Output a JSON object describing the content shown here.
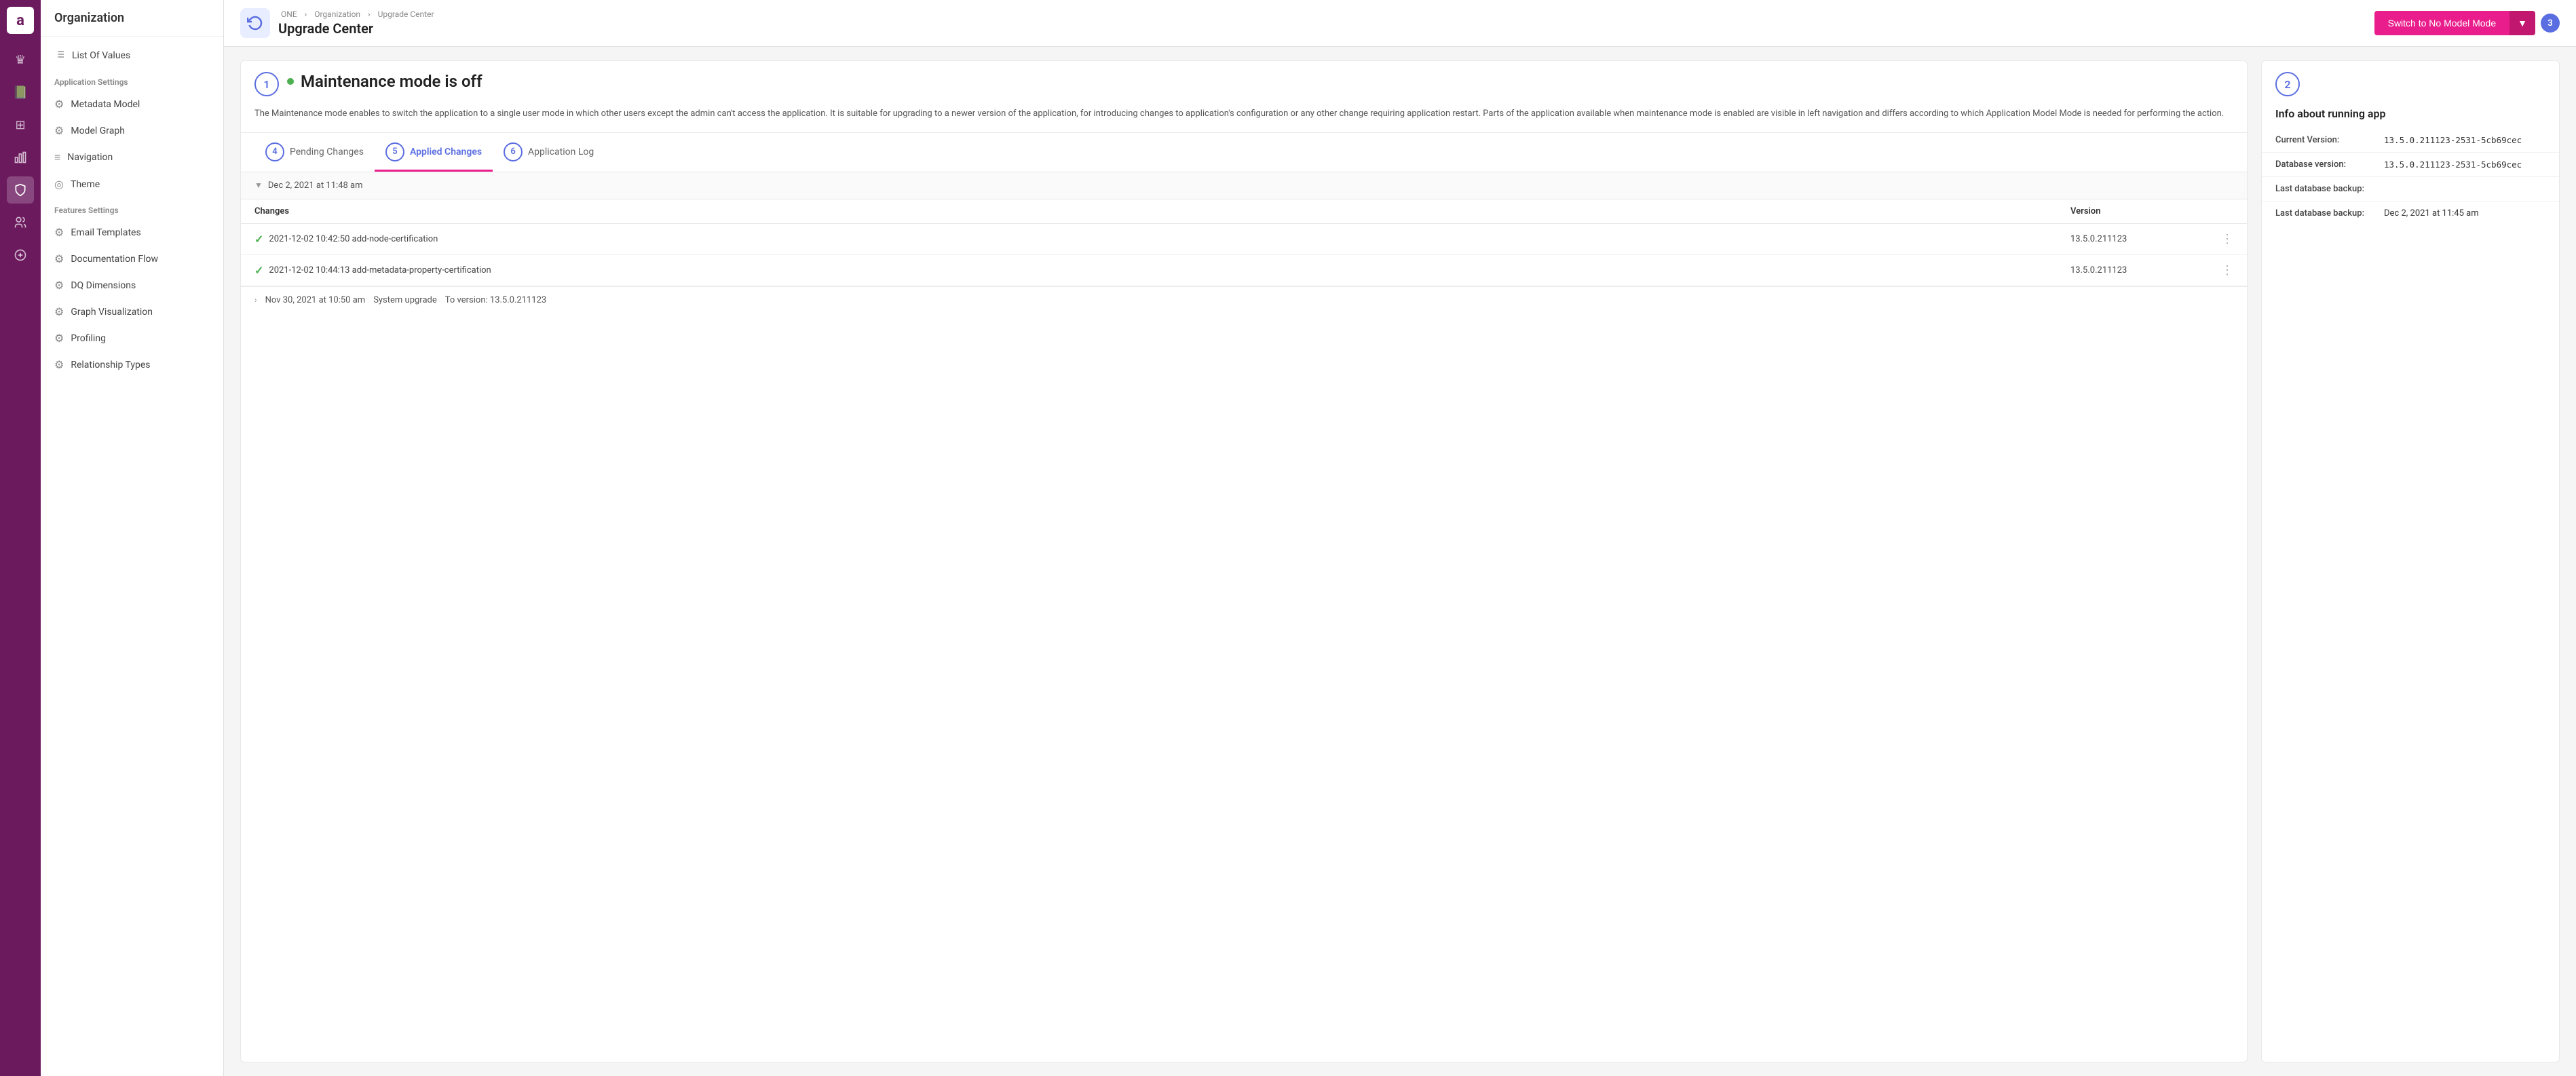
{
  "iconBar": {
    "logo": "a",
    "icons": [
      {
        "name": "crown-icon",
        "symbol": "♛",
        "active": false
      },
      {
        "name": "book-icon",
        "symbol": "📖",
        "active": false
      },
      {
        "name": "grid-icon",
        "symbol": "⊞",
        "active": false
      },
      {
        "name": "chart-icon",
        "symbol": "⊿",
        "active": false
      },
      {
        "name": "shield-icon",
        "symbol": "🛡",
        "active": true
      },
      {
        "name": "people-icon",
        "symbol": "👥",
        "active": false
      },
      {
        "name": "plus-circle-icon",
        "symbol": "⊕",
        "active": false
      }
    ]
  },
  "sidebar": {
    "orgTitle": "Organization",
    "topItems": [
      {
        "label": "List Of Values",
        "icon": "≡",
        "name": "list-of-values"
      }
    ],
    "sections": [
      {
        "label": "Application Settings",
        "items": [
          {
            "label": "Metadata Model",
            "icon": "⚙",
            "name": "metadata-model"
          },
          {
            "label": "Model Graph",
            "icon": "⚙",
            "name": "model-graph"
          },
          {
            "label": "Navigation",
            "icon": "≡",
            "name": "navigation"
          },
          {
            "label": "Theme",
            "icon": "⊙",
            "name": "theme"
          }
        ]
      },
      {
        "label": "Features Settings",
        "items": [
          {
            "label": "Email Templates",
            "icon": "⚙",
            "name": "email-templates"
          },
          {
            "label": "Documentation Flow",
            "icon": "⚙",
            "name": "documentation-flow"
          },
          {
            "label": "DQ Dimensions",
            "icon": "⚙",
            "name": "dq-dimensions"
          },
          {
            "label": "Graph Visualization",
            "icon": "⚙",
            "name": "graph-visualization"
          },
          {
            "label": "Profiling",
            "icon": "⚙",
            "name": "profiling"
          },
          {
            "label": "Relationship Types",
            "icon": "⚙",
            "name": "relationship-types"
          }
        ]
      }
    ]
  },
  "header": {
    "breadcrumb": [
      "ONE",
      "Organization",
      "Upgrade Center"
    ],
    "title": "Upgrade Center",
    "iconSymbol": "↻",
    "switchButton": "Switch to No Model Mode",
    "dropdownLabel": "▼",
    "badge3": "3"
  },
  "maintenancePanel": {
    "num": "1",
    "title": "Maintenance mode is off",
    "dotColor": "#4caf50",
    "description": "The Maintenance mode enables to switch the application to a single user mode in which other users except the admin can't access the application. It is suitable for upgrading to a newer version of the application, for introducing changes to application's configuration or any other change requiring application restart. Parts of the application available when maintenance mode is enabled are visible in left navigation and differs according to which Application Model Mode is needed for performing the action.",
    "tabs": [
      {
        "label": "Pending Changes",
        "num": "4",
        "active": false
      },
      {
        "label": "Applied Changes",
        "num": "5",
        "active": true
      },
      {
        "label": "Application Log",
        "num": "6",
        "active": false
      }
    ],
    "dateRow": "Dec 2, 2021 at 11:48 am",
    "tableHeaders": [
      "Changes",
      "Version",
      ""
    ],
    "tableRows": [
      {
        "check": true,
        "change": "2021-12-02 10:42:50 add-node-certification",
        "version": "13.5.0.211123",
        "hasDots": true
      },
      {
        "check": true,
        "change": "2021-12-02 10:44:13 add-metadata-property-certification",
        "version": "13.5.0.211123",
        "hasDots": true
      }
    ],
    "systemRow": {
      "date": "Nov 30, 2021 at 10:50 am",
      "label": "System upgrade",
      "toVersion": "To version: 13.5.0.211123"
    }
  },
  "infoPanel": {
    "num": "2",
    "title": "Info about running app",
    "rows": [
      {
        "label": "Current Version:",
        "value": "13.5.0.211123-2531-5cb69cec",
        "mono": true
      },
      {
        "label": "Database version:",
        "value": "13.5.0.211123-2531-5cb69cec",
        "mono": true
      },
      {
        "label": "Last database backup:",
        "value": "",
        "mono": false
      },
      {
        "label": "Last database backup:",
        "value": "Dec 2, 2021 at 11:45 am",
        "mono": false
      }
    ]
  }
}
